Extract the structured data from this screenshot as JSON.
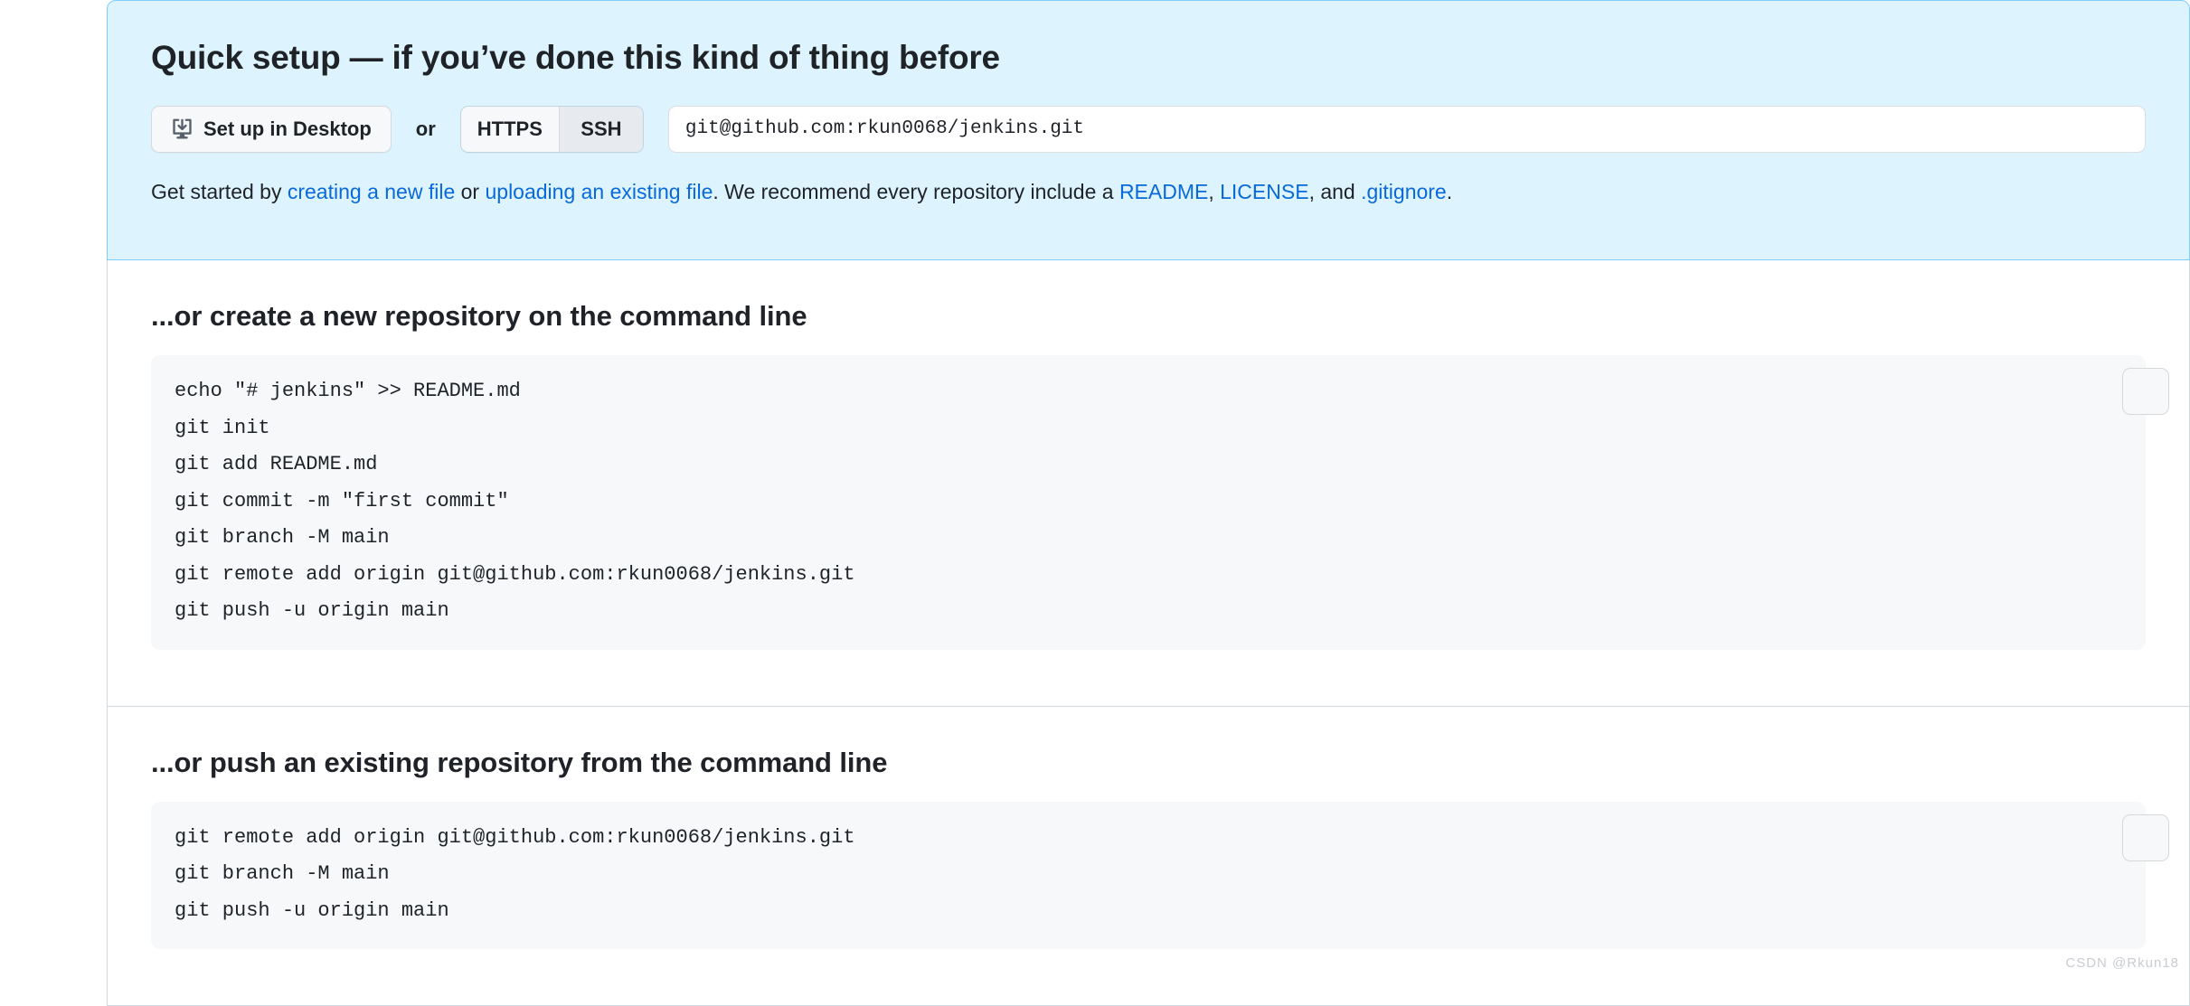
{
  "quick_setup": {
    "title": "Quick setup — if you’ve done this kind of thing before",
    "desktop_button_label": "Set up in Desktop",
    "desktop_icon": "desktop-download-icon",
    "or_label": "or",
    "protocols": [
      {
        "label": "HTTPS",
        "selected": false
      },
      {
        "label": "SSH",
        "selected": true
      }
    ],
    "remote_url": "git@github.com:rkun0068/jenkins.git",
    "get_started": {
      "prefix": "Get started by ",
      "link_create": "creating a new file",
      "mid_or": " or ",
      "link_upload": "uploading an existing file",
      "recommend": ". We recommend every repository include a ",
      "link_readme": "README",
      "sep1": ", ",
      "link_license": "LICENSE",
      "sep2": ", and ",
      "link_gitignore": ".gitignore",
      "suffix": "."
    }
  },
  "create_repo_section": {
    "title": "...or create a new repository on the command line",
    "copy_button_label": "copy-icon",
    "code": "echo \"# jenkins\" >> README.md\ngit init\ngit add README.md\ngit commit -m \"first commit\"\ngit branch -M main\ngit remote add origin git@github.com:rkun0068/jenkins.git\ngit push -u origin main"
  },
  "push_repo_section": {
    "title": "...or push an existing repository from the command line",
    "copy_button_label": "copy-icon",
    "code": "git remote add origin git@github.com:rkun0068/jenkins.git\ngit branch -M main\ngit push -u origin main"
  },
  "watermark": "CSDN @Rkun18",
  "colors": {
    "panel_bg": "#ddf4ff",
    "panel_border": "#80ccff",
    "link": "#0969da",
    "code_bg": "#f6f8fa",
    "section_border": "#d1d9e0",
    "text": "#1f2328"
  }
}
